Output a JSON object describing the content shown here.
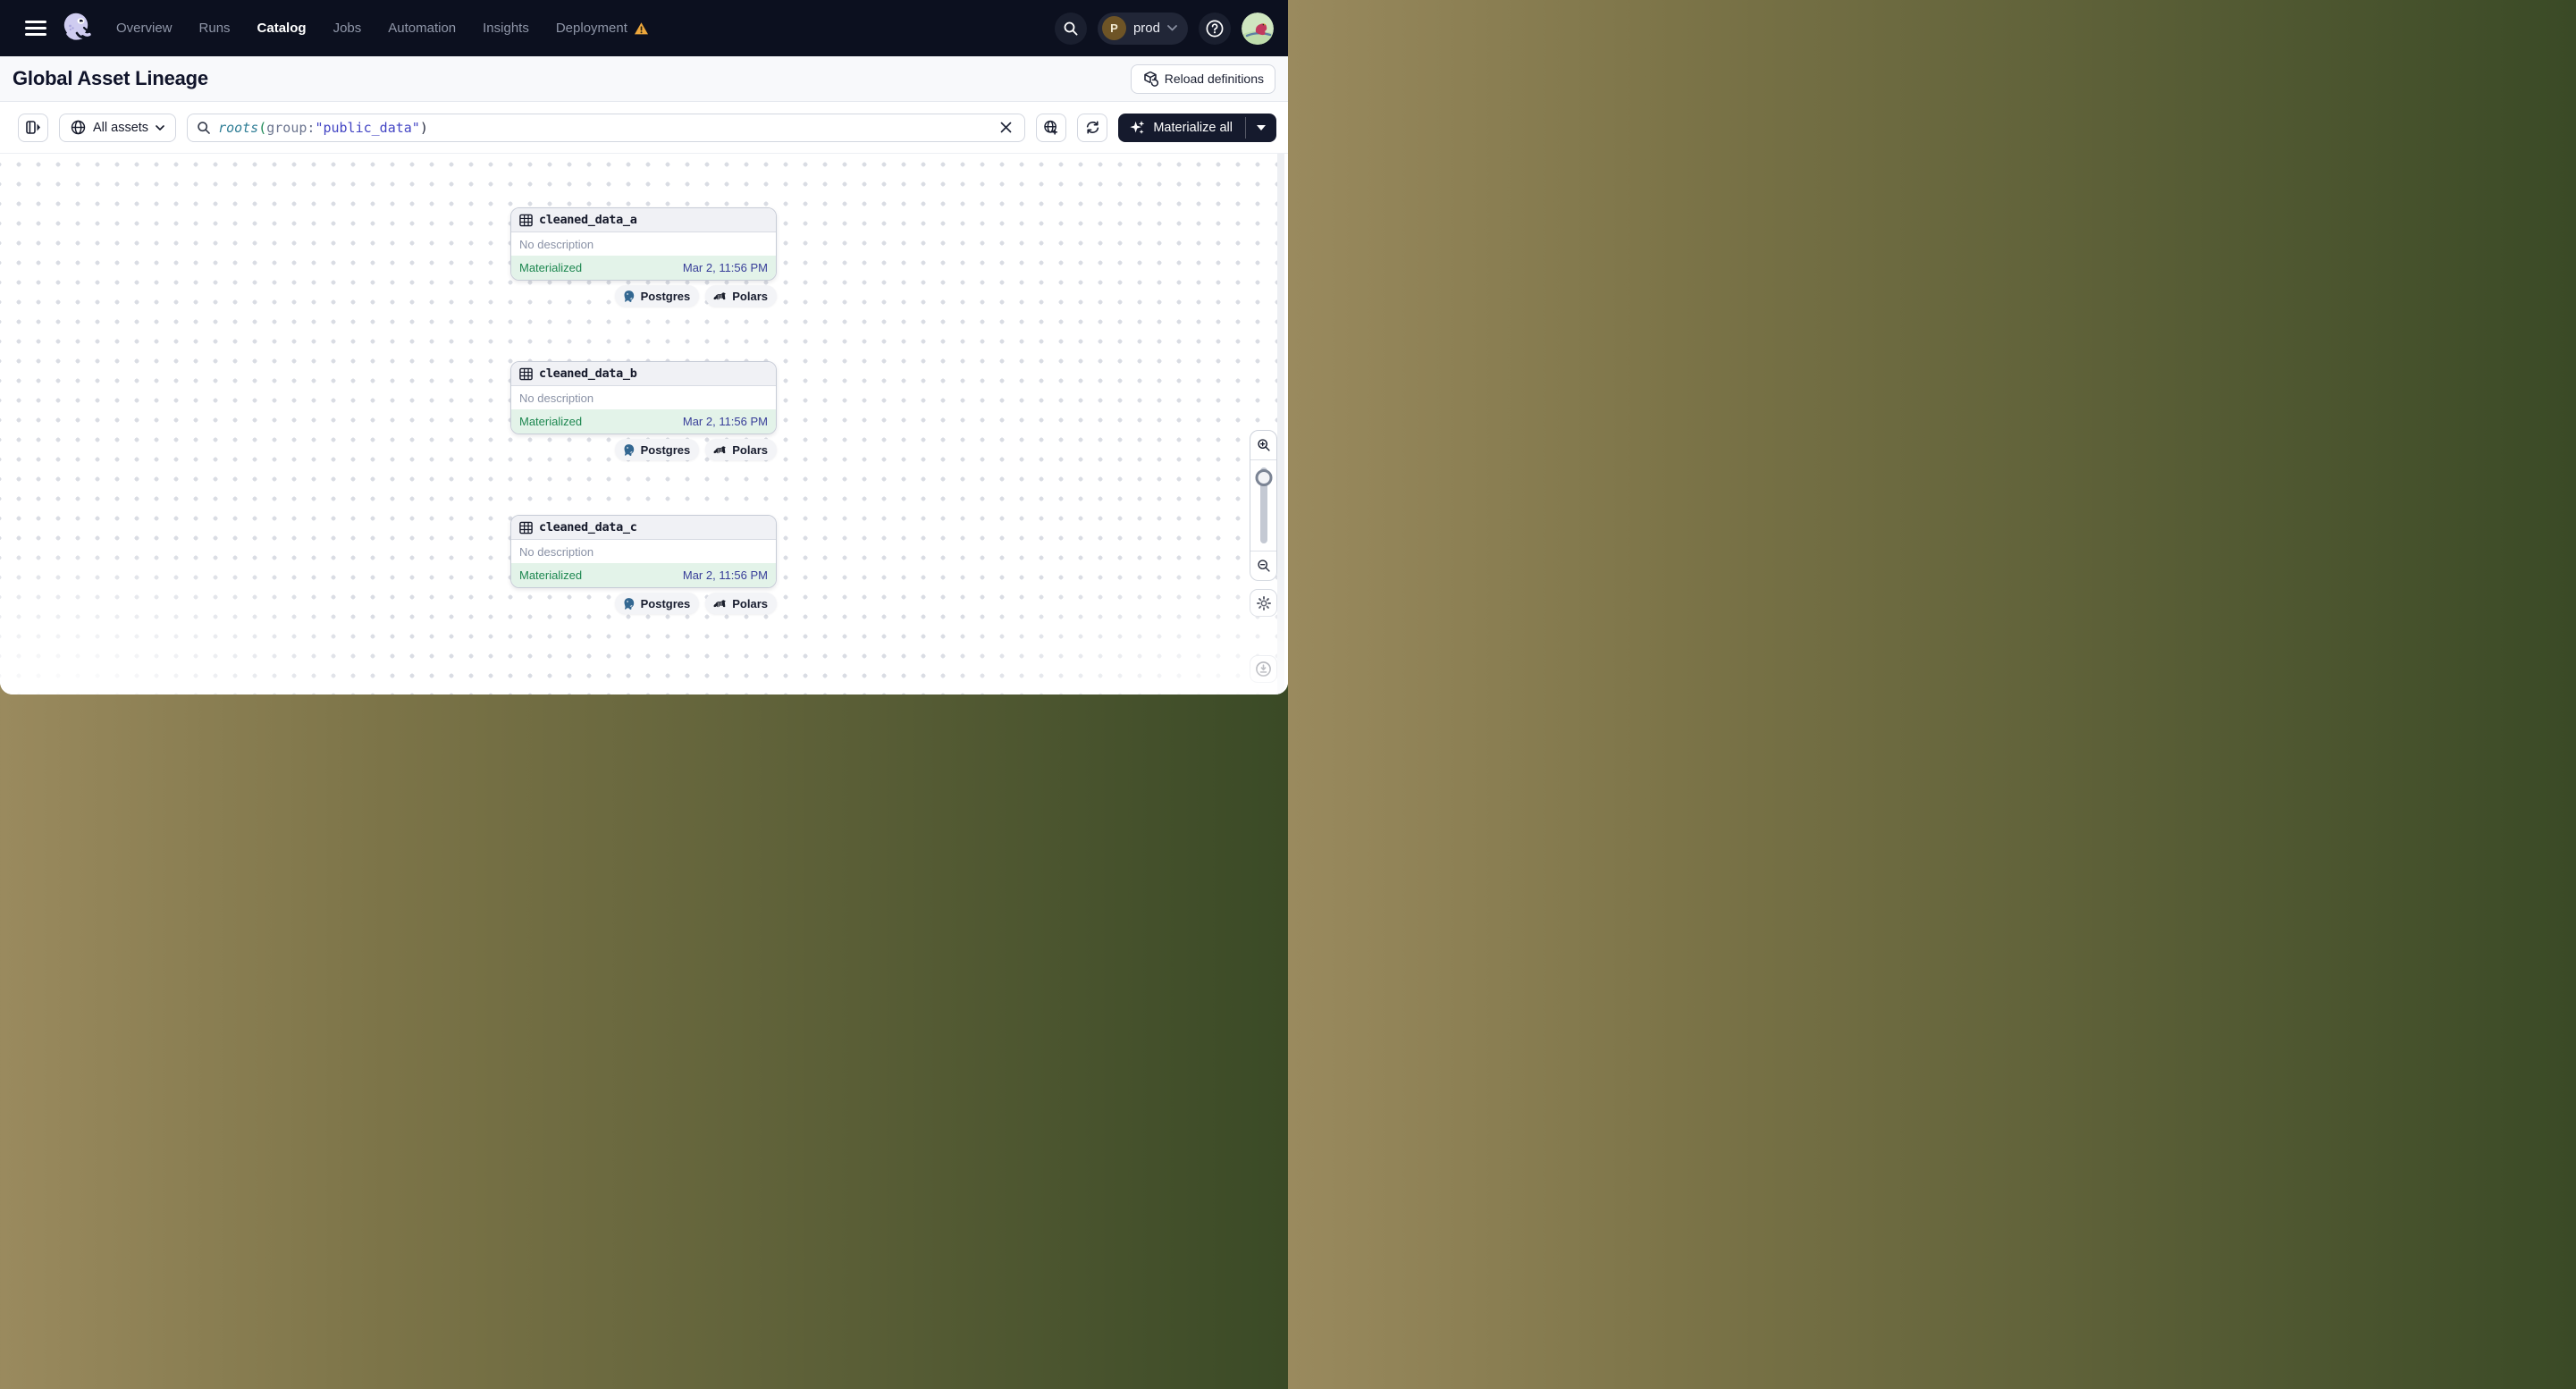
{
  "nav": {
    "items": [
      {
        "label": "Overview",
        "active": false
      },
      {
        "label": "Runs",
        "active": false
      },
      {
        "label": "Catalog",
        "active": true
      },
      {
        "label": "Jobs",
        "active": false
      },
      {
        "label": "Automation",
        "active": false
      },
      {
        "label": "Insights",
        "active": false
      },
      {
        "label": "Deployment",
        "active": false,
        "warning": true
      }
    ],
    "environment": {
      "initial": "P",
      "name": "prod"
    }
  },
  "header": {
    "title": "Global Asset Lineage",
    "reload_button": "Reload definitions"
  },
  "toolbar": {
    "filter_label": "All assets",
    "query": {
      "function": "roots",
      "open_paren": "(",
      "attribute": "group",
      "colon": ":",
      "value": "\"public_data\"",
      "close_paren": ")"
    },
    "materialize_label": "Materialize all"
  },
  "graph": {
    "nodes": [
      {
        "name": "cleaned_data_a",
        "description": "No description",
        "status": "Materialized",
        "timestamp": "Mar 2, 11:56 PM",
        "tags": [
          {
            "label": "Postgres"
          },
          {
            "label": "Polars"
          }
        ]
      },
      {
        "name": "cleaned_data_b",
        "description": "No description",
        "status": "Materialized",
        "timestamp": "Mar 2, 11:56 PM",
        "tags": [
          {
            "label": "Postgres"
          },
          {
            "label": "Polars"
          }
        ]
      },
      {
        "name": "cleaned_data_c",
        "description": "No description",
        "status": "Materialized",
        "timestamp": "Mar 2, 11:56 PM",
        "tags": [
          {
            "label": "Postgres"
          },
          {
            "label": "Polars"
          }
        ]
      }
    ]
  },
  "colors": {
    "nav_bg": "#0c101f",
    "materialized_green": "#1d8750",
    "materialized_bg": "#e3f3e9",
    "timestamp_indigo": "#383e99",
    "warning_orange": "#eda73c",
    "postgres_blue": "#336791",
    "query_function_teal": "#2f7e96",
    "query_value_indigo": "#4345c4"
  }
}
